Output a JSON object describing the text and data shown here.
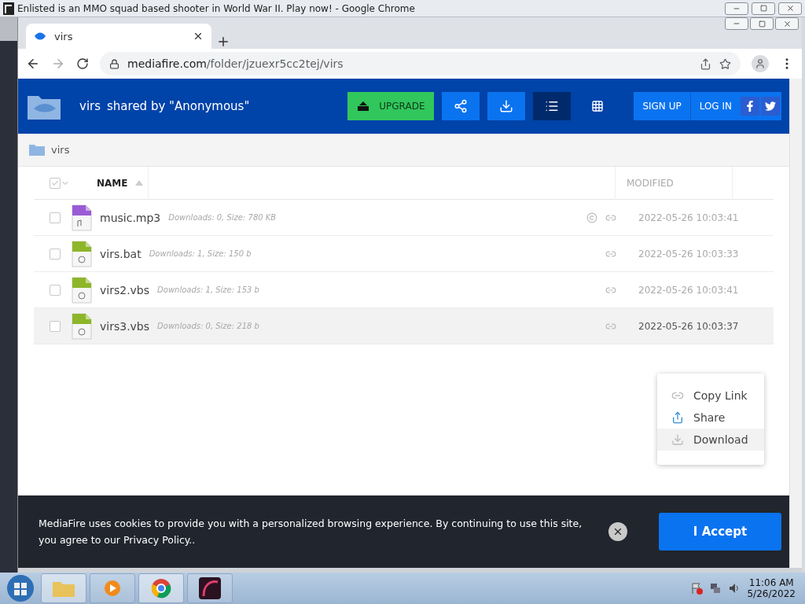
{
  "window": {
    "title": "Enlisted is an MMO squad based shooter in World War II. Play now! - Google Chrome"
  },
  "tabs": [
    {
      "label": "virs",
      "selected": true
    }
  ],
  "address_bar": {
    "url_host": "mediafire.com",
    "url_path": "/folder/jzuexr5cc2tej/virs"
  },
  "header": {
    "folder_name": "virs",
    "shared_by": "shared by \"Anonymous\"",
    "upgrade": "UPGRADE",
    "views": [
      {
        "kind": "list",
        "selected": true
      },
      {
        "kind": "grid",
        "selected": false
      }
    ],
    "sign_up": "SIGN UP",
    "log_in": "LOG IN"
  },
  "breadcrumb": [
    {
      "label": "virs"
    }
  ],
  "table": {
    "select_all": {
      "checked": false
    },
    "columns": [
      {
        "label": "NAME",
        "sorted": true
      },
      {
        "label": "MODIFIED",
        "sorted": false
      }
    ],
    "rows": [
      {
        "kind": "audio",
        "name": "music.mp3",
        "meta": "Downloads: 0, Size: 780 KB",
        "modified": "2022-05-26 10:03:41",
        "copyright": true,
        "checked": false,
        "selected": false
      },
      {
        "kind": "code",
        "name": "virs.bat",
        "meta": "Downloads: 1, Size: 150 b",
        "modified": "2022-05-26 10:03:33",
        "copyright": false,
        "checked": false,
        "selected": false
      },
      {
        "kind": "code",
        "name": "virs2.vbs",
        "meta": "Downloads: 1, Size: 153 b",
        "modified": "2022-05-26 10:03:41",
        "copyright": false,
        "checked": false,
        "selected": false
      },
      {
        "kind": "code",
        "name": "virs3.vbs",
        "meta": "Downloads: 0, Size: 218 b",
        "modified": "2022-05-26 10:03:37",
        "copyright": false,
        "checked": false,
        "selected": true
      }
    ]
  },
  "context_menu": [
    {
      "kind": "link",
      "label": "Copy Link",
      "selected": false
    },
    {
      "kind": "share",
      "label": "Share",
      "selected": false
    },
    {
      "kind": "download",
      "label": "Download",
      "selected": true
    }
  ],
  "cookie_bar": {
    "text": "MediaFire uses cookies to provide you with a personalized browsing experience. By continuing to use this site, you agree to our Privacy Policy..",
    "accept": "I Accept"
  },
  "taskbar": {
    "time": "11:06 AM",
    "date": "5/26/2022"
  }
}
